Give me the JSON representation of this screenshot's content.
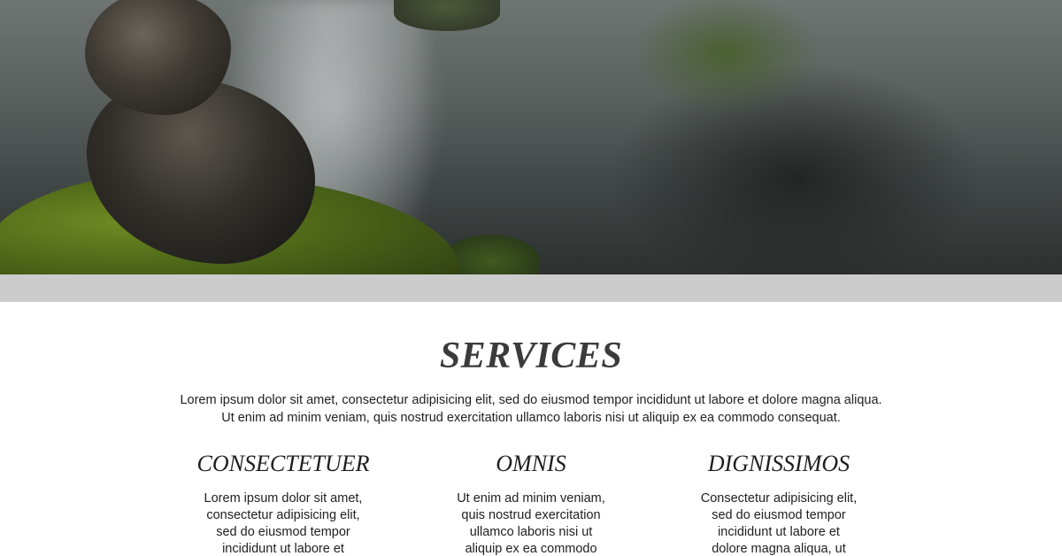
{
  "hero": {
    "image": "stacked-stones-stream-photo"
  },
  "services": {
    "title": "SERVICES",
    "intro_line1": "Lorem ipsum dolor sit amet, consectetur adipisicing elit, sed do eiusmod tempor incididunt ut labore et dolore magna aliqua.",
    "intro_line2": "Ut enim ad minim veniam, quis nostrud exercitation ullamco laboris nisi ut aliquip ex ea commodo consequat.",
    "columns": [
      {
        "title": "CONSECTETUER",
        "lines": [
          "Lorem ipsum dolor sit amet,",
          "consectetur adipisicing elit,",
          "sed do eiusmod tempor",
          "incididunt ut labore et"
        ]
      },
      {
        "title": "OMNIS",
        "lines": [
          "Ut enim ad minim veniam,",
          "quis nostrud exercitation",
          "ullamco laboris nisi ut",
          "aliquip ex ea commodo"
        ]
      },
      {
        "title": "DIGNISSIMOS",
        "lines": [
          "Consectetur adipisicing elit,",
          "sed do eiusmod tempor",
          "incididunt ut labore et",
          "dolore magna aliqua, ut"
        ]
      }
    ]
  }
}
